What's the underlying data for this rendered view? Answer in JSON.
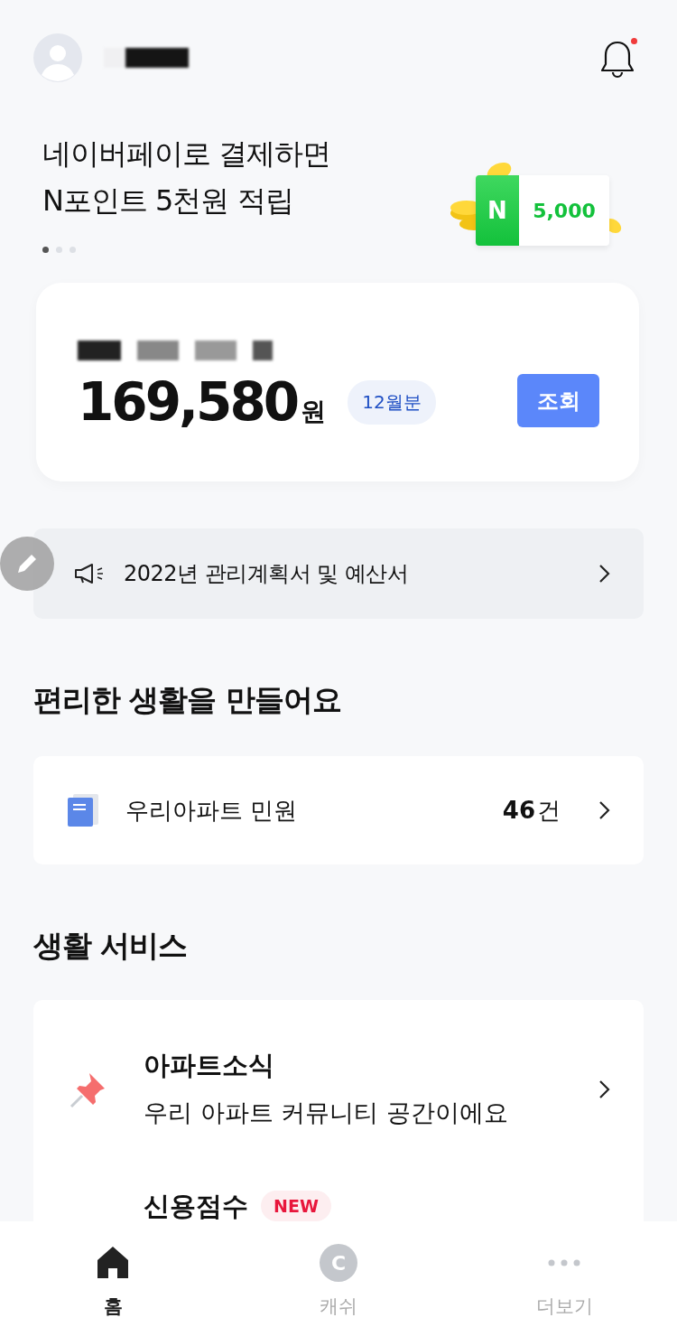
{
  "header": {
    "has_notification": true
  },
  "promo": {
    "lines": [
      "네이버페이로 결제하면",
      "N포인트 5천원 적립"
    ],
    "logo_letter": "N",
    "amount": "5,000",
    "pages": [
      {
        "selected": true
      },
      {
        "selected": false
      },
      {
        "selected": false
      }
    ]
  },
  "bill": {
    "amount": "169,580",
    "unit": "원",
    "period": "12월분",
    "button": "조회"
  },
  "notice": {
    "text": "2022년 관리계획서 및 예산서"
  },
  "convenience": {
    "title": "편리한 생활을 만들어요",
    "item": {
      "label": "우리아파트 민원",
      "count": "46",
      "count_unit": "건"
    }
  },
  "services": {
    "title": "생활 서비스",
    "items": [
      {
        "title": "아파트소식",
        "subtitle": "우리 아파트 커뮤니티 공간이에요"
      },
      {
        "title": "신용점수",
        "badge": "NEW"
      }
    ]
  },
  "nav": [
    {
      "kind": "home",
      "label": "홈",
      "selected": true
    },
    {
      "kind": "cash",
      "label": "캐쉬",
      "icon_letter": "C",
      "selected": false
    },
    {
      "kind": "more",
      "label": "더보기",
      "selected": false
    }
  ]
}
